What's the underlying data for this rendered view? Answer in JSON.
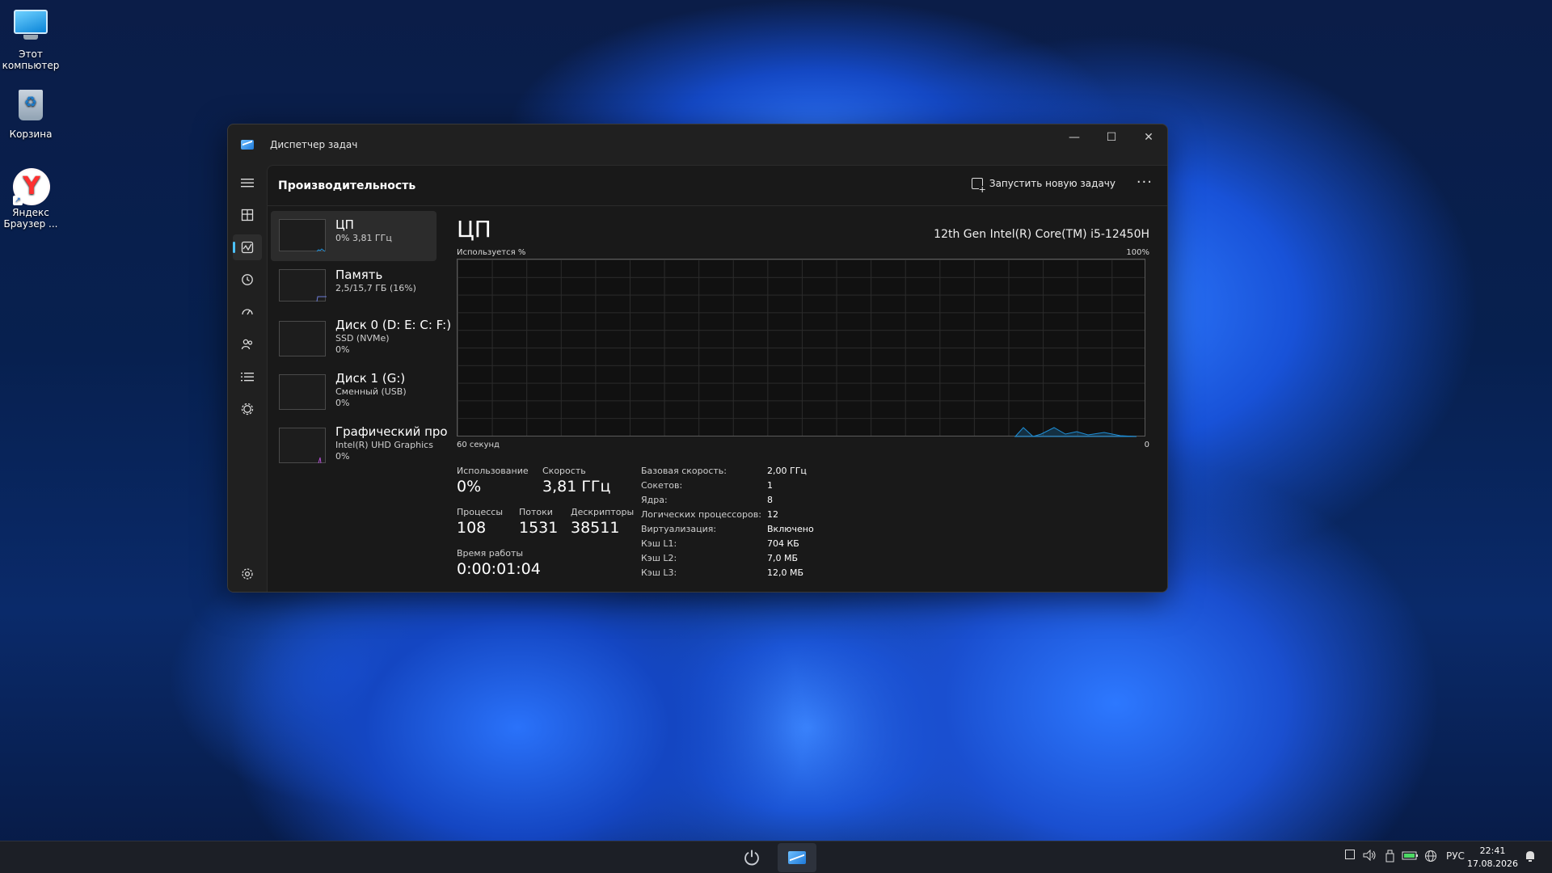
{
  "desktop": {
    "icons": [
      {
        "label": "Этот компьютер"
      },
      {
        "label": "Корзина"
      },
      {
        "label": "Яндекс Браузер ..."
      }
    ]
  },
  "window": {
    "title": "Диспетчер задач",
    "header_title": "Производительность",
    "run_task_label": "Запустить новую задачу",
    "more_label": "···",
    "controls": {
      "minimize": "—",
      "maximize": "☐",
      "close": "✕"
    }
  },
  "sidebar": {
    "items": [
      {
        "icon": "hamburger-icon"
      },
      {
        "icon": "processes-icon"
      },
      {
        "icon": "performance-icon"
      },
      {
        "icon": "app-history-icon"
      },
      {
        "icon": "startup-apps-icon"
      },
      {
        "icon": "users-icon"
      },
      {
        "icon": "details-icon"
      },
      {
        "icon": "services-icon"
      },
      {
        "icon": "settings-icon"
      }
    ]
  },
  "resources": [
    {
      "title": "ЦП",
      "line2": "0% 3,81 ГГц",
      "line3": ""
    },
    {
      "title": "Память",
      "line2": "2,5/15,7 ГБ (16%)",
      "line3": ""
    },
    {
      "title": "Диск 0 (D: E: C: F:)",
      "line2": "SSD (NVMe)",
      "line3": "0%"
    },
    {
      "title": "Диск 1 (G:)",
      "line2": "Сменный (USB)",
      "line3": "0%"
    },
    {
      "title": "Графический про",
      "line2": "Intel(R) UHD Graphics",
      "line3": "0%"
    }
  ],
  "cpu": {
    "title": "ЦП",
    "model": "12th Gen Intel(R) Core(TM) i5-12450H",
    "graph_top_left": "Используется %",
    "graph_top_right": "100%",
    "graph_bottom_left": "60 секунд",
    "graph_bottom_right": "0",
    "usage_label": "Использование",
    "usage_value": "0%",
    "speed_label": "Скорость",
    "speed_value": "3,81 ГГц",
    "processes_label": "Процессы",
    "processes_value": "108",
    "threads_label": "Потоки",
    "threads_value": "1531",
    "handles_label": "Дескрипторы",
    "handles_value": "38511",
    "uptime_label": "Время работы",
    "uptime_value": "0:00:01:04",
    "specs": [
      {
        "k": "Базовая скорость:",
        "v": "2,00 ГГц"
      },
      {
        "k": "Сокетов:",
        "v": "1"
      },
      {
        "k": "Ядра:",
        "v": "8"
      },
      {
        "k": "Логических процессоров:",
        "v": "12"
      },
      {
        "k": "Виртуализация:",
        "v": "Включено"
      },
      {
        "k": "Кэш L1:",
        "v": "704 КБ"
      },
      {
        "k": "Кэш L2:",
        "v": "7,0 МБ"
      },
      {
        "k": "Кэш L3:",
        "v": "12,0 МБ"
      }
    ]
  },
  "taskbar": {
    "language": "РУС",
    "time": "22:41",
    "date": "17.08.2026"
  }
}
